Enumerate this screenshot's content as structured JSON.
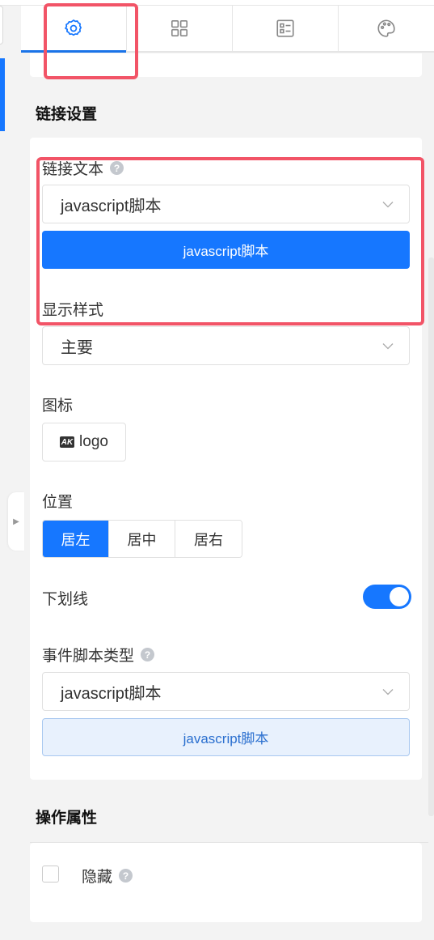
{
  "tabs": [
    {
      "name": "settings",
      "icon": "gear-icon",
      "active": true
    },
    {
      "name": "components",
      "icon": "grid-icon",
      "active": false
    },
    {
      "name": "form",
      "icon": "list-icon",
      "active": false
    },
    {
      "name": "theme",
      "icon": "palette-icon",
      "active": false
    }
  ],
  "link_settings": {
    "title": "链接设置",
    "link_text_label": "链接文本",
    "link_text_select": "javascript脚本",
    "link_text_button": "javascript脚本",
    "display_style_label": "显示样式",
    "display_style_select": "主要",
    "icon_label": "图标",
    "icon_button": "logo",
    "position_label": "位置",
    "position_options": [
      "居左",
      "居中",
      "居右"
    ],
    "position_selected": "居左",
    "underline_label": "下划线",
    "underline_on": true,
    "event_script_label": "事件脚本类型",
    "event_script_select": "javascript脚本",
    "event_script_button": "javascript脚本"
  },
  "operation_attrs": {
    "title": "操作属性",
    "hidden_label": "隐藏",
    "hidden_checked": false
  },
  "colors": {
    "primary": "#1677ff",
    "highlight": "#f25467"
  }
}
